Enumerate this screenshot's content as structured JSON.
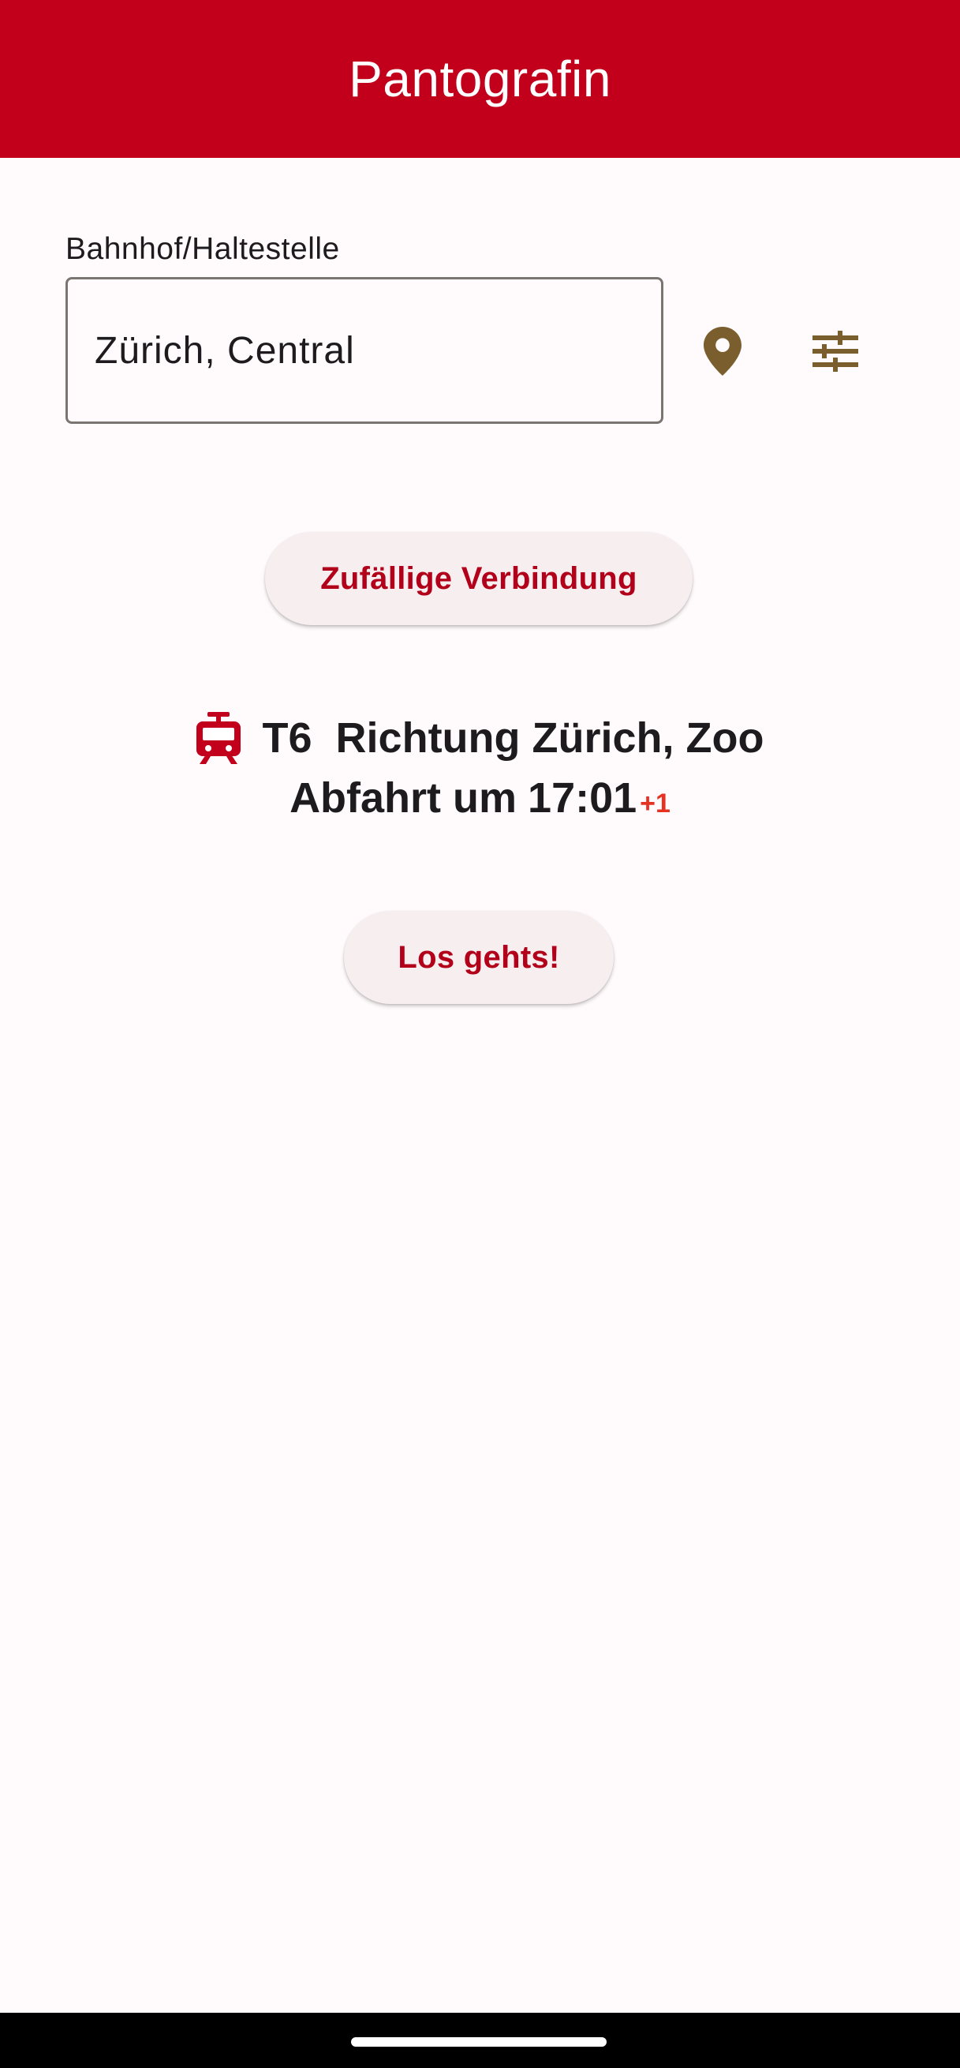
{
  "app_bar": {
    "title": "Pantografin",
    "background_color": "#c2001b"
  },
  "station": {
    "label": "Bahnhof/Haltestelle",
    "value": "Zürich, Central"
  },
  "actions": {
    "location_icon": "location-pin-icon",
    "filter_icon": "tune-sliders-icon",
    "random_button_label": "Zufällige Verbindung",
    "go_button_label": "Los gehts!"
  },
  "connection": {
    "vehicle_icon": "tram-icon",
    "line": "T6",
    "direction": "Richtung Zürich, Zoo",
    "departure_label": "Abfahrt um",
    "departure_time": "17:01",
    "delay": "+1"
  },
  "colors": {
    "accent": "#c2001b",
    "button_text": "#b3001a",
    "button_bg": "#f7eef0",
    "icon_brown": "#7a5e2e",
    "delay_red": "#e53222"
  }
}
